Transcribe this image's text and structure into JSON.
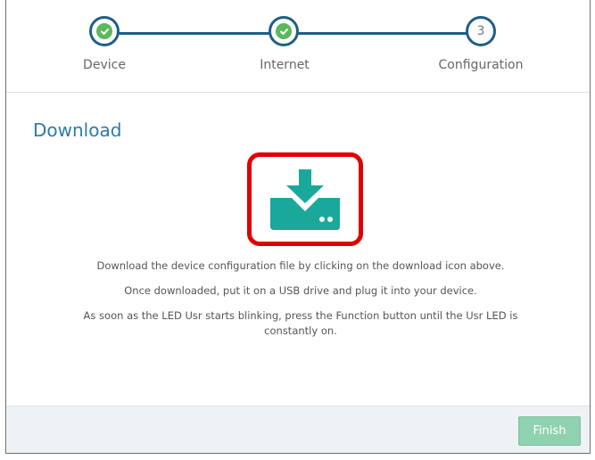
{
  "stepper": {
    "steps": [
      {
        "label": "Device",
        "state": "complete",
        "marker": ""
      },
      {
        "label": "Internet",
        "state": "complete",
        "marker": ""
      },
      {
        "label": "Configuration",
        "state": "current",
        "marker": "3"
      }
    ]
  },
  "panel": {
    "title": "Download",
    "download_icon": "download-to-drive-icon"
  },
  "instructions": {
    "line1": "Download the device configuration file by clicking on the download icon above.",
    "line2": "Once downloaded, put it on a USB drive and plug it into your device.",
    "line3": "As soon as the LED Usr starts blinking, press the Function button until the Usr LED is constantly on."
  },
  "footer": {
    "finish_label": "Finish"
  },
  "colors": {
    "stepper_line": "#1f5f87",
    "check": "#5cb85c",
    "accent": "#2b7ca6",
    "icon": "#1aa89a",
    "highlight_border": "#e00000",
    "finish_button": "#8fd1b0"
  }
}
